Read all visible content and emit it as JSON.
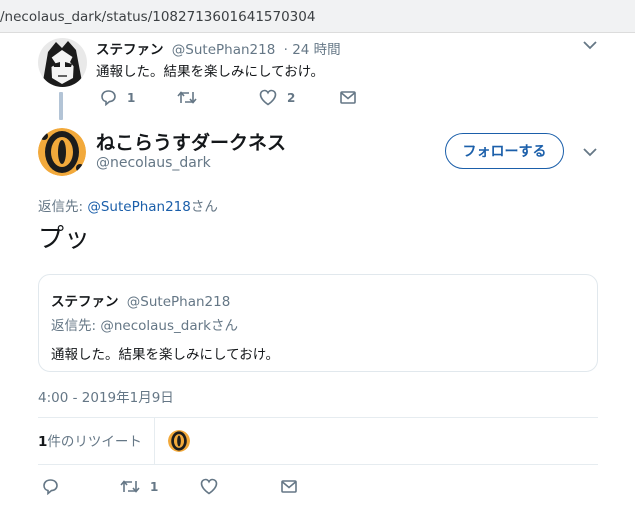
{
  "browser": {
    "url": "/necolaus_dark/status/1082713601641570304"
  },
  "parent_tweet": {
    "display_name": "ステファン",
    "handle": "@SutePhan218",
    "time": "· 24 時間",
    "text": "通報した。結果を楽しみにしておけ。",
    "reply_count": "1",
    "retweet_count": "",
    "like_count": "2"
  },
  "main_tweet": {
    "display_name": "ねこらうすダークネス",
    "handle": "@necolaus_dark",
    "follow_label": "フォローする",
    "reply_to_prefix": "返信先: ",
    "reply_to_handle": "@SutePhan218",
    "reply_to_suffix": "さん",
    "text": "プッ",
    "timestamp": "4:00 - 2019年1月9日",
    "retweet_stat_count": "1",
    "retweet_stat_label": "件のリツイート",
    "reply_count": "",
    "retweet_count": "1",
    "like_count": ""
  },
  "quoted_tweet": {
    "display_name": "ステファン",
    "handle": "@SutePhan218",
    "reply_to": "返信先: @necolaus_darkさん",
    "text": "通報した。結果を楽しみにしておけ。"
  },
  "icons": [
    "chevron-down-icon",
    "reply-icon",
    "retweet-icon",
    "like-icon",
    "dm-icon"
  ],
  "colors": {
    "link": "#1b5faa",
    "muted": "#657786",
    "thread_line": "#b3c4d6",
    "avatar_orange": "#f2a93b"
  }
}
